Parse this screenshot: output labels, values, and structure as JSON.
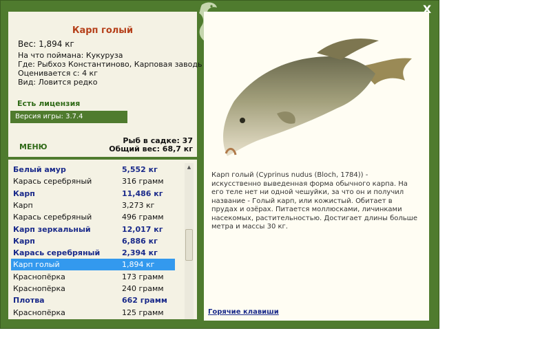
{
  "window": {
    "close_label": "X"
  },
  "fish": {
    "title": "Карп голый",
    "weight": "Вес: 1,894 кг",
    "bait": "На что поймана: Кукуруза",
    "place": "Где: Рыбхоз Константиново, Карповая заводь",
    "rating": "Оценивается с: 4 кг",
    "kind": "Вид: Ловится редко"
  },
  "license": "Есть лицензия",
  "version": "Версия игры: 3.7.4",
  "menu_label": "МЕНЮ",
  "stats": {
    "fish_count": "Рыб в садке: 37",
    "total_weight": "Общий вес: 68,7 кг"
  },
  "catch_list": [
    {
      "name": "Белый амур",
      "weight": "5,552 кг",
      "bold": true
    },
    {
      "name": "Карась серебряный",
      "weight": "316 грамм",
      "bold": false
    },
    {
      "name": "Карп",
      "weight": "11,486 кг",
      "bold": true
    },
    {
      "name": "Карп",
      "weight": "3,273 кг",
      "bold": false
    },
    {
      "name": "Карась серебряный",
      "weight": "496 грамм",
      "bold": false
    },
    {
      "name": "Карп зеркальный",
      "weight": "12,017 кг",
      "bold": true
    },
    {
      "name": "Карп",
      "weight": "6,886 кг",
      "bold": true
    },
    {
      "name": "Карась серебряный",
      "weight": "2,394 кг",
      "bold": true
    },
    {
      "name": "Карп голый",
      "weight": "1,894 кг",
      "bold": false,
      "selected": true
    },
    {
      "name": "Краснопёрка",
      "weight": "173 грамм",
      "bold": false
    },
    {
      "name": "Краснопёрка",
      "weight": "240 грамм",
      "bold": false
    },
    {
      "name": "Плотва",
      "weight": "662 грамм",
      "bold": true
    },
    {
      "name": "Краснопёрка",
      "weight": "125 грамм",
      "bold": false
    }
  ],
  "description": "Карп голый (Cyprinus nudus (Bloch, 1784)) - искусственно выведенная форма обычного карпа. На его теле нет ни одной чешуйки, за что он и получил название - Голый карп, или кожистый. Обитает в прудах и озёрах. Питается моллюсками, личинками насекомых, растительностью. Достигает длины больше метра и массы 30 кг.",
  "hotkeys_label": "Горячие клавиши",
  "colors": {
    "frame": "#4f7b2e",
    "panel": "#f4f2e4",
    "selected": "#3399ee",
    "title": "#b5401a"
  },
  "icons": {
    "logo": "fish-logo-icon",
    "close": "close-icon"
  }
}
